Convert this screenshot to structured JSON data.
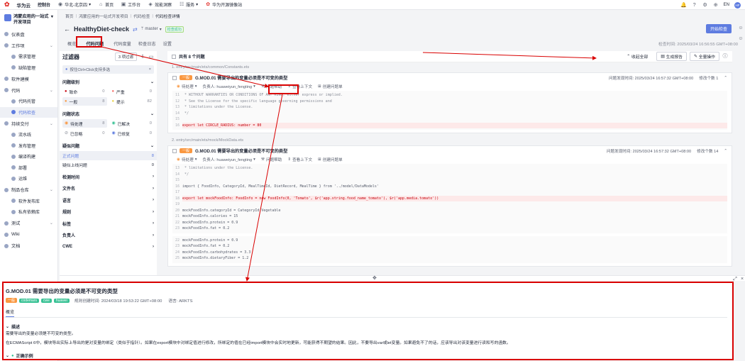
{
  "topbar": {
    "logo": "华为云",
    "console": "控制台",
    "region": "华北-北京四",
    "home": "首页",
    "workbench": "工作台",
    "efficiency": "效能洞察",
    "service": "服务",
    "forum": "华为开源镜像站",
    "lang": "EN",
    "avatar": "HF"
  },
  "sidebar": {
    "project": "鸿蒙应用的一站式开发项目",
    "items": [
      {
        "label": "仪表盘",
        "type": "item"
      },
      {
        "label": "工作项",
        "type": "group"
      },
      {
        "label": "需求管理",
        "type": "sub"
      },
      {
        "label": "缺陷管理",
        "type": "sub"
      },
      {
        "label": "软件建模",
        "type": "item"
      },
      {
        "label": "代码",
        "type": "group"
      },
      {
        "label": "代码托管",
        "type": "sub"
      },
      {
        "label": "代码检查",
        "type": "sub",
        "active": true
      },
      {
        "label": "持续交付",
        "type": "group"
      },
      {
        "label": "流水线",
        "type": "sub"
      },
      {
        "label": "发布管理",
        "type": "sub"
      },
      {
        "label": "编译构建",
        "type": "sub"
      },
      {
        "label": "部署",
        "type": "sub"
      },
      {
        "label": "运维",
        "type": "sub"
      },
      {
        "label": "制品仓库",
        "type": "group"
      },
      {
        "label": "软件发布库",
        "type": "sub"
      },
      {
        "label": "私有依赖库",
        "type": "sub"
      },
      {
        "label": "测试",
        "type": "group"
      },
      {
        "label": "Wiki",
        "type": "item"
      },
      {
        "label": "文档",
        "type": "item"
      }
    ]
  },
  "breadcrumb": [
    "首页",
    "鸿蒙应用的一站式开发项目",
    "代码检查",
    "代码检查详情"
  ],
  "title": {
    "name": "HealthyDiet-check",
    "branch": "master",
    "status": "检查成功",
    "start_button": "开始检查",
    "check_time": "检查时间: 2025/03/24 16:56:55 GMT+08:00"
  },
  "tabs": [
    "概览",
    "代码问题",
    "代码度量",
    "检查日志",
    "设置"
  ],
  "filter": {
    "title": "过滤器",
    "selected": "3 项过滤",
    "hint": "按住Ctrl+Click支持多选",
    "level_title": "问题级别",
    "levels": [
      {
        "label": "致命",
        "count": "0"
      },
      {
        "label": "严重",
        "count": "0"
      },
      {
        "label": "一般",
        "count": "8"
      },
      {
        "label": "提示",
        "count": "82"
      }
    ],
    "status_title": "问题状态",
    "statuses": [
      {
        "label": "待处理",
        "count": "8"
      },
      {
        "label": "已解决",
        "count": "0"
      },
      {
        "label": "已忽略",
        "count": "0"
      },
      {
        "label": "已修复",
        "count": "0"
      }
    ],
    "defect_title": "疑似问题",
    "defects": [
      {
        "label": "正式问题",
        "count": "8"
      },
      {
        "label": "疑似上线问题",
        "count": "0"
      }
    ],
    "others": [
      "检测时间",
      "文件名",
      "语言",
      "规则",
      "标签",
      "负责人",
      "CWE"
    ]
  },
  "content": {
    "total": "共有 8 个问题",
    "collapse": "收起全部",
    "report": "生成报告",
    "batch": "全量操作",
    "issues": [
      {
        "path": "1. entry/src/main/ets/common/Constants.ets",
        "level": "一般",
        "title": "G.MOD.01 需要导出的变量必须是不可变的类型",
        "found": "问题发现时间:  2025/03/24 16:57:32 GMT+08:00",
        "fix": "修改个数 1",
        "status": "待处理",
        "owner": "负责人:  huaweiyun_fengting",
        "help": "问题帮助",
        "context": "查看上下文",
        "create": "创建问题单",
        "lines": [
          {
            "n": "11",
            "t": " * WITHOUT WARRANTIES OR CONDITIONS OF ANY KIND, either express or implied.",
            "c": "cm"
          },
          {
            "n": "12",
            "t": " * See the License for the specific language governing permissions and",
            "c": "cm"
          },
          {
            "n": "13",
            "t": " * limitations under the License.",
            "c": "cm"
          },
          {
            "n": "14",
            "t": " */",
            "c": "cm"
          },
          {
            "n": "15",
            "t": "",
            "c": ""
          },
          {
            "n": "16",
            "t": "export let CIRCLE_RADIUS: number = 80",
            "c": "red"
          }
        ]
      },
      {
        "path": "2. entry/src/main/ets/mock/MockData.ets",
        "level": "一般",
        "title": "G.MOD.01 需要导出的变量必须是不可变的类型",
        "found": "问题发现时间:  2025/03/24 16:57:32 GMT+08:00",
        "fix": "修改个数 14",
        "status": "待处理",
        "owner": "负责人:  huaweiyun_fengting",
        "help": "问题帮助",
        "context": "查看上下文",
        "create": "创建问题单",
        "lines": [
          {
            "n": "13",
            "t": " * limitations under the License.",
            "c": "cm"
          },
          {
            "n": "14",
            "t": " */",
            "c": "cm"
          },
          {
            "n": "15",
            "t": "",
            "c": ""
          },
          {
            "n": "16",
            "t": "import { FoodInfo, CategoryId, MealTimeId, DietRecord, MealTime } from '../model/DataModels'",
            "c": ""
          },
          {
            "n": "17",
            "t": "",
            "c": ""
          },
          {
            "n": "18",
            "t": "export let mockFoodInfo: FoodInfo = new FoodInfo(0, 'Tomato', $r('app.string.food_name_tomato'), $r('app.media.tomato'))",
            "c": "red"
          },
          {
            "n": "19",
            "t": "",
            "c": ""
          },
          {
            "n": "20",
            "t": "mockFoodInfo.categoryId = CategoryId.Vegetable",
            "c": ""
          },
          {
            "n": "21",
            "t": "mockFoodInfo.calories = 15",
            "c": ""
          },
          {
            "n": "22",
            "t": "mockFoodInfo.protein = 0.9",
            "c": ""
          },
          {
            "n": "23",
            "t": "mockFoodInfo.fat = 0.2",
            "c": ""
          }
        ],
        "lines2": [
          {
            "n": "22",
            "t": "mockFoodInfo.protein = 0.9",
            "c": ""
          },
          {
            "n": "23",
            "t": "mockFoodInfo.fat = 0.2",
            "c": ""
          },
          {
            "n": "24",
            "t": "mockFoodInfo.carbohydrates = 3.3",
            "c": ""
          },
          {
            "n": "25",
            "t": "mockFoodInfo.dietaryFiber = 1.2",
            "c": ""
          }
        ]
      }
    ]
  },
  "detail": {
    "title": "G.MOD.01 需要导出的变量必须是不可变的类型",
    "tags": [
      "一般",
      "codemars",
      "cwe",
      "huawei"
    ],
    "created": "规则创建时间: 2024/03/18 19:53:22 GMT+08:00",
    "language": "语言: ARKTS",
    "tab": "概览",
    "desc_title": "描述",
    "desc1": "需要导出的变量必须是不可变的类型。",
    "desc2": "在ECMAScript 6中，模块导出实际上导出的是对变量的绑定（类似于指针）。如果在export模块中对绑定值进行修改，所绑定的值在已经import模块中会实时地更新，可能获得不期望的结果。因此，不要导出var或let变量。如果避免不了的话，应该导出对该变量进行读和写的函数。",
    "example": "正确示例"
  },
  "colors": {
    "accent": "#5e7ce0",
    "annotation": "#d90000",
    "level_general": "#fa9841"
  }
}
